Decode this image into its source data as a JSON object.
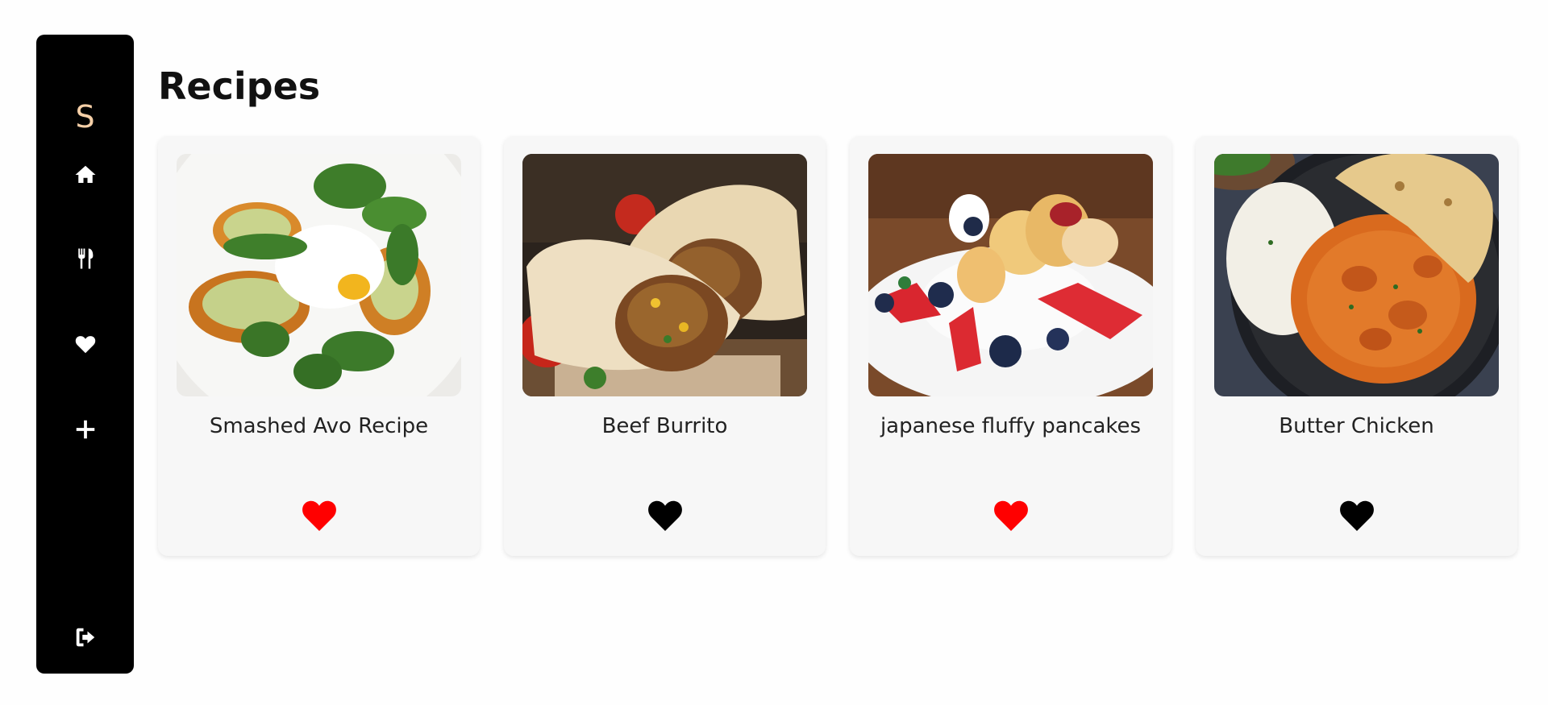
{
  "sidebar": {
    "logo": "S",
    "logo_color": "#f5cfa7",
    "items": [
      {
        "name": "home",
        "icon": "home-icon"
      },
      {
        "name": "recipes",
        "icon": "utensils-icon"
      },
      {
        "name": "favorites",
        "icon": "heart-icon"
      },
      {
        "name": "add",
        "icon": "plus-icon"
      },
      {
        "name": "logout",
        "icon": "sign-out-icon"
      }
    ]
  },
  "main": {
    "title": "Recipes",
    "recipes": [
      {
        "title": "Smashed Avo Recipe",
        "favorited": true,
        "image": "smashed-avo-photo"
      },
      {
        "title": "Beef Burrito",
        "favorited": false,
        "image": "beef-burrito-photo"
      },
      {
        "title": "japanese fluffy pancakes",
        "favorited": true,
        "image": "fluffy-pancakes-photo"
      },
      {
        "title": "Butter Chicken",
        "favorited": false,
        "image": "butter-chicken-photo"
      }
    ]
  },
  "colors": {
    "favorited": "#ff0000",
    "not_favorited": "#000000",
    "sidebar_bg": "#000000"
  }
}
